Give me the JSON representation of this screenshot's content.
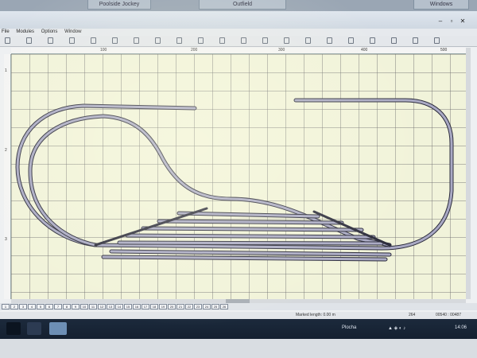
{
  "top_tabs": [
    "Poolside Jockey",
    "Outfield",
    "Windows"
  ],
  "menu": {
    "items": [
      "File",
      "Modules",
      "Options",
      "Window"
    ]
  },
  "ruler": {
    "top_labels": [
      "100",
      "200",
      "300",
      "400",
      "500"
    ],
    "left_labels": [
      "1",
      "2",
      "3"
    ]
  },
  "toolbar_icons": [
    "new-icon",
    "open-icon",
    "save-icon",
    "print-icon",
    "undo-icon",
    "redo-icon",
    "cut-icon",
    "copy-icon",
    "paste-icon",
    "zoom-in-icon",
    "zoom-out-icon",
    "select-icon",
    "straight-track-icon",
    "curve-track-icon",
    "turnout-icon",
    "crossing-icon",
    "flex-track-icon",
    "measure-icon",
    "text-icon",
    "layer-icon",
    "help-icon"
  ],
  "page_tabs": [
    "1",
    "2",
    "3",
    "4",
    "5",
    "6",
    "7",
    "8",
    "9",
    "10",
    "11",
    "12",
    "13",
    "14",
    "15",
    "16",
    "17",
    "18",
    "19",
    "20",
    "21",
    "22",
    "23",
    "24",
    "25",
    "26"
  ],
  "status": {
    "marked_length": "Marked length: 0.00 m",
    "zoom": "264",
    "coords": "00540 : 00487"
  },
  "taskbar": {
    "tray_label": "Plocha",
    "clock": "14:06"
  },
  "colors": {
    "canvas": "#f1f3da",
    "grid": "#6e6e6e",
    "rail_fill": "#a9a9c4",
    "rail_edge": "#2c2c3c"
  }
}
